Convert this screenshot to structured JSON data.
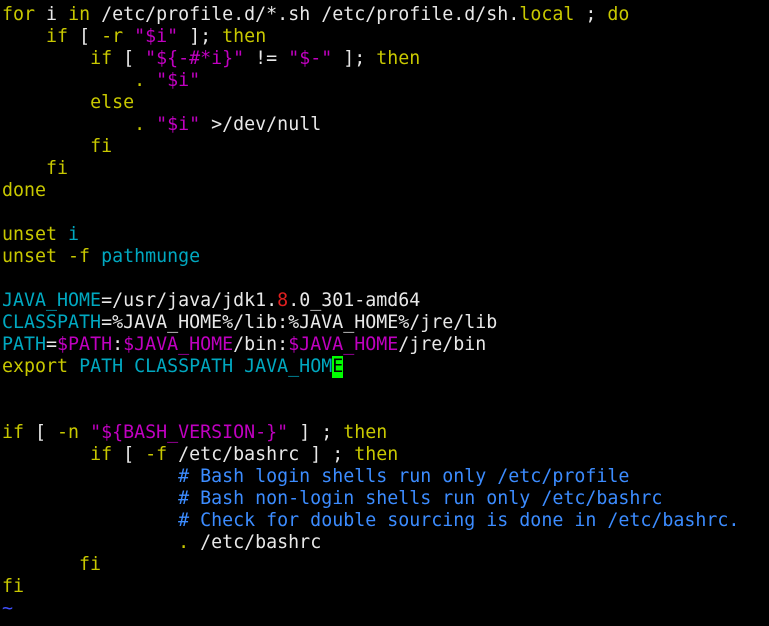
{
  "colors": {
    "background": "#000000",
    "keyword": "#c8c800",
    "string": "#c000c0",
    "variable": "#00a8c0",
    "comment": "#3c8cff",
    "number": "#e02020",
    "plain": "#e8e8e8",
    "cursor": "#00ff00",
    "tilde": "#4050ff"
  },
  "editor": {
    "cursor_position": {
      "line": 17,
      "column": 31
    },
    "lines": [
      [
        {
          "t": "for",
          "c": "keyword"
        },
        {
          "t": " i ",
          "c": "plain"
        },
        {
          "t": "in",
          "c": "keyword"
        },
        {
          "t": " /etc/profile.d/*.sh /etc/profile.d/sh.",
          "c": "plain"
        },
        {
          "t": "local",
          "c": "keyword"
        },
        {
          "t": " ; ",
          "c": "plain"
        },
        {
          "t": "do",
          "c": "keyword"
        }
      ],
      [
        {
          "t": "    ",
          "c": "plain"
        },
        {
          "t": "if",
          "c": "keyword"
        },
        {
          "t": " [ ",
          "c": "plain"
        },
        {
          "t": "-r",
          "c": "keyword"
        },
        {
          "t": " ",
          "c": "plain"
        },
        {
          "t": "\"$i\"",
          "c": "string"
        },
        {
          "t": " ]; ",
          "c": "plain"
        },
        {
          "t": "then",
          "c": "keyword"
        }
      ],
      [
        {
          "t": "        ",
          "c": "plain"
        },
        {
          "t": "if",
          "c": "keyword"
        },
        {
          "t": " [ ",
          "c": "plain"
        },
        {
          "t": "\"${-#*i}\"",
          "c": "string"
        },
        {
          "t": " != ",
          "c": "plain"
        },
        {
          "t": "\"$-\"",
          "c": "string"
        },
        {
          "t": " ]; ",
          "c": "plain"
        },
        {
          "t": "then",
          "c": "keyword"
        }
      ],
      [
        {
          "t": "            ",
          "c": "plain"
        },
        {
          "t": ".",
          "c": "keyword"
        },
        {
          "t": " ",
          "c": "plain"
        },
        {
          "t": "\"$i\"",
          "c": "string"
        }
      ],
      [
        {
          "t": "        ",
          "c": "plain"
        },
        {
          "t": "else",
          "c": "keyword"
        }
      ],
      [
        {
          "t": "            ",
          "c": "plain"
        },
        {
          "t": ".",
          "c": "keyword"
        },
        {
          "t": " ",
          "c": "plain"
        },
        {
          "t": "\"$i\"",
          "c": "string"
        },
        {
          "t": " >/dev/null",
          "c": "plain"
        }
      ],
      [
        {
          "t": "        ",
          "c": "plain"
        },
        {
          "t": "fi",
          "c": "keyword"
        }
      ],
      [
        {
          "t": "    ",
          "c": "plain"
        },
        {
          "t": "fi",
          "c": "keyword"
        }
      ],
      [
        {
          "t": "done",
          "c": "keyword"
        }
      ],
      [],
      [
        {
          "t": "unset",
          "c": "keyword"
        },
        {
          "t": " ",
          "c": "plain"
        },
        {
          "t": "i",
          "c": "variable"
        }
      ],
      [
        {
          "t": "unset",
          "c": "keyword"
        },
        {
          "t": " ",
          "c": "plain"
        },
        {
          "t": "-f",
          "c": "keyword"
        },
        {
          "t": " ",
          "c": "plain"
        },
        {
          "t": "pathmunge",
          "c": "variable"
        }
      ],
      [],
      [
        {
          "t": "JAVA_HOME",
          "c": "variable"
        },
        {
          "t": "=/usr/java/jdk1.",
          "c": "plain"
        },
        {
          "t": "8",
          "c": "number"
        },
        {
          "t": ".0_301-amd64",
          "c": "plain"
        }
      ],
      [
        {
          "t": "CLASSPATH",
          "c": "variable"
        },
        {
          "t": "=%JAVA_HOME%/lib:%JAVA_HOME%/jre/lib",
          "c": "plain"
        }
      ],
      [
        {
          "t": "PATH",
          "c": "variable"
        },
        {
          "t": "=",
          "c": "plain"
        },
        {
          "t": "$PATH",
          "c": "string"
        },
        {
          "t": ":",
          "c": "plain"
        },
        {
          "t": "$JAVA_HOME",
          "c": "string"
        },
        {
          "t": "/bin:",
          "c": "plain"
        },
        {
          "t": "$JAVA_HOME",
          "c": "string"
        },
        {
          "t": "/jre/bin",
          "c": "plain"
        }
      ],
      [
        {
          "t": "export",
          "c": "keyword"
        },
        {
          "t": " ",
          "c": "plain"
        },
        {
          "t": "PATH CLASSPATH JAVA_HOM",
          "c": "variable"
        },
        {
          "t": "E",
          "c": "cursor"
        }
      ],
      [],
      [],
      [
        {
          "t": "if",
          "c": "keyword"
        },
        {
          "t": " [ ",
          "c": "plain"
        },
        {
          "t": "-n",
          "c": "keyword"
        },
        {
          "t": " ",
          "c": "plain"
        },
        {
          "t": "\"${BASH_VERSION-}\"",
          "c": "string"
        },
        {
          "t": " ] ; ",
          "c": "plain"
        },
        {
          "t": "then",
          "c": "keyword"
        }
      ],
      [
        {
          "t": "        ",
          "c": "plain"
        },
        {
          "t": "if",
          "c": "keyword"
        },
        {
          "t": " [ ",
          "c": "plain"
        },
        {
          "t": "-f",
          "c": "keyword"
        },
        {
          "t": " /etc/bashrc ] ; ",
          "c": "plain"
        },
        {
          "t": "then",
          "c": "keyword"
        }
      ],
      [
        {
          "t": "                ",
          "c": "plain"
        },
        {
          "t": "# Bash login shells run only /etc/profile",
          "c": "comment"
        }
      ],
      [
        {
          "t": "                ",
          "c": "plain"
        },
        {
          "t": "# Bash non-login shells run only /etc/bashrc",
          "c": "comment"
        }
      ],
      [
        {
          "t": "                ",
          "c": "plain"
        },
        {
          "t": "# Check for double sourcing is done in /etc/bashrc.",
          "c": "comment"
        }
      ],
      [
        {
          "t": "                ",
          "c": "plain"
        },
        {
          "t": ".",
          "c": "keyword"
        },
        {
          "t": " /etc/bashrc",
          "c": "plain"
        }
      ],
      [
        {
          "t": "       ",
          "c": "plain"
        },
        {
          "t": "fi",
          "c": "keyword"
        }
      ],
      [
        {
          "t": "fi",
          "c": "keyword"
        }
      ],
      [
        {
          "t": "~",
          "c": "tilde"
        }
      ]
    ]
  }
}
